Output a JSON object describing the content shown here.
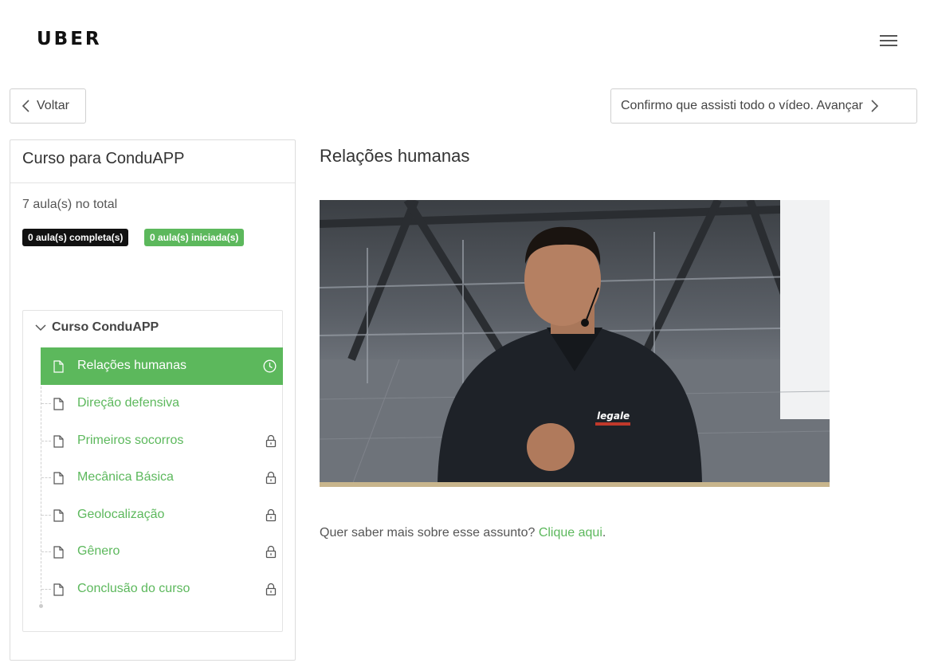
{
  "header": {
    "brand": "UBER",
    "menu_icon": "hamburger-menu-icon"
  },
  "nav": {
    "back_label": "Voltar",
    "next_label": "Confirmo que assisti todo o vídeo. Avançar"
  },
  "course": {
    "title": "Curso para ConduAPP",
    "total": "7 aula(s) no total",
    "badges": {
      "completed": "0 aula(s) completa(s)",
      "started": "0 aula(s) iniciada(s)"
    },
    "module": {
      "name": "Curso ConduAPP",
      "lessons": [
        {
          "label": "Relações humanas",
          "status": "in-progress",
          "icon": "clock-icon"
        },
        {
          "label": "Direção defensiva",
          "status": "available",
          "icon": ""
        },
        {
          "label": "Primeiros socorros",
          "status": "locked",
          "icon": "lock-icon"
        },
        {
          "label": "Mecânica Básica",
          "status": "locked",
          "icon": "lock-icon"
        },
        {
          "label": "Geolocalização",
          "status": "locked",
          "icon": "lock-icon"
        },
        {
          "label": "Gênero",
          "status": "locked",
          "icon": "lock-icon"
        },
        {
          "label": "Conclusão do curso",
          "status": "locked",
          "icon": "lock-icon"
        }
      ]
    }
  },
  "lesson": {
    "title": "Relações humanas",
    "more_info_text": "Quer saber mais sobre esse assunto?",
    "more_info_link": "Clique aqui",
    "more_info_suffix": ".",
    "shirt_logo": "legale"
  },
  "colors": {
    "accent": "#5cb85c",
    "dark_badge": "#111111"
  }
}
